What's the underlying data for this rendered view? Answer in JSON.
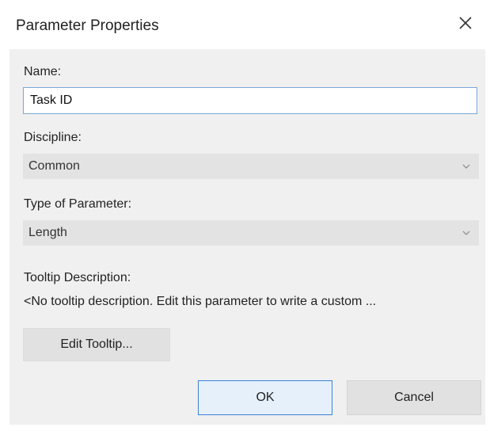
{
  "dialog": {
    "title": "Parameter Properties",
    "close_icon": "close-icon"
  },
  "name": {
    "label": "Name:",
    "value": "Task ID"
  },
  "discipline": {
    "label": "Discipline:",
    "selected": "Common",
    "icon": "chevron-down-icon"
  },
  "type_of_parameter": {
    "label": "Type of Parameter:",
    "selected": "Length",
    "icon": "chevron-down-icon"
  },
  "tooltip": {
    "label": "Tooltip Description:",
    "text": "<No tooltip description. Edit this parameter to write a custom ...",
    "edit_button_label": "Edit Tooltip..."
  },
  "buttons": {
    "ok_label": "OK",
    "cancel_label": "Cancel"
  },
  "colors": {
    "dialog_background": "#f0f0f0",
    "input_border": "#7aa7d9",
    "ok_border": "#3c83d6"
  }
}
